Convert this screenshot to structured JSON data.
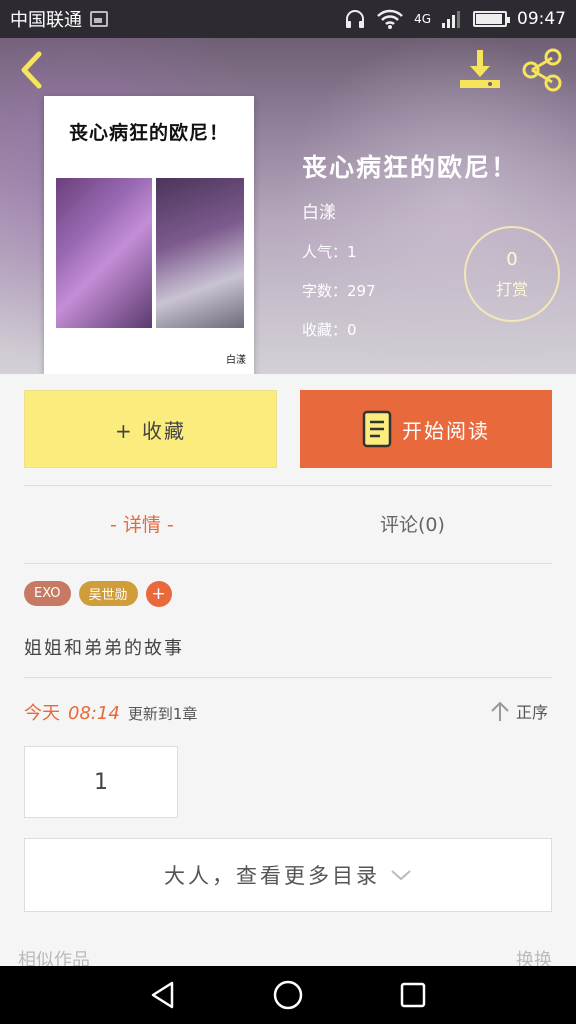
{
  "status_bar": {
    "carrier": "中国联通",
    "network": "4G",
    "time": "09:47",
    "battery_level": 0.85
  },
  "book": {
    "cover_title": "丧心病狂的欧尼！",
    "cover_author": "白漾",
    "title": "丧心病狂的欧尼！",
    "author": "白漾",
    "popularity": "人气：1",
    "word_count": "字数：297",
    "favorites": "收藏：0"
  },
  "reward": {
    "count": "0",
    "label": "打赏"
  },
  "actions": {
    "favorite_label": "+ 收藏",
    "read_label": "开始阅读"
  },
  "tabs": {
    "detail": "- 详情 -",
    "comments": "评论(0)"
  },
  "tags": [
    "EXO",
    "吴世勋"
  ],
  "tag_add": "+",
  "description": "姐姐和弟弟的故事",
  "update": {
    "day": "今天",
    "time": "08:14",
    "text": "更新到1章"
  },
  "sort_label": "正序",
  "chapter": "1",
  "more_catalog": "大人，查看更多目录",
  "similar": {
    "title": "相似作品",
    "switch": "换换"
  },
  "colors": {
    "accent": "#e8693b",
    "favorite_button": "#fbec7e",
    "tag_exo": "#c77a63",
    "tag_name": "#cf9e3b"
  },
  "icons": {
    "back": "back-arrow-icon",
    "download": "download-icon",
    "share": "share-icon",
    "book": "book-icon",
    "sort": "sort-up-arrow-icon",
    "expand": "chevron-down-icon"
  }
}
